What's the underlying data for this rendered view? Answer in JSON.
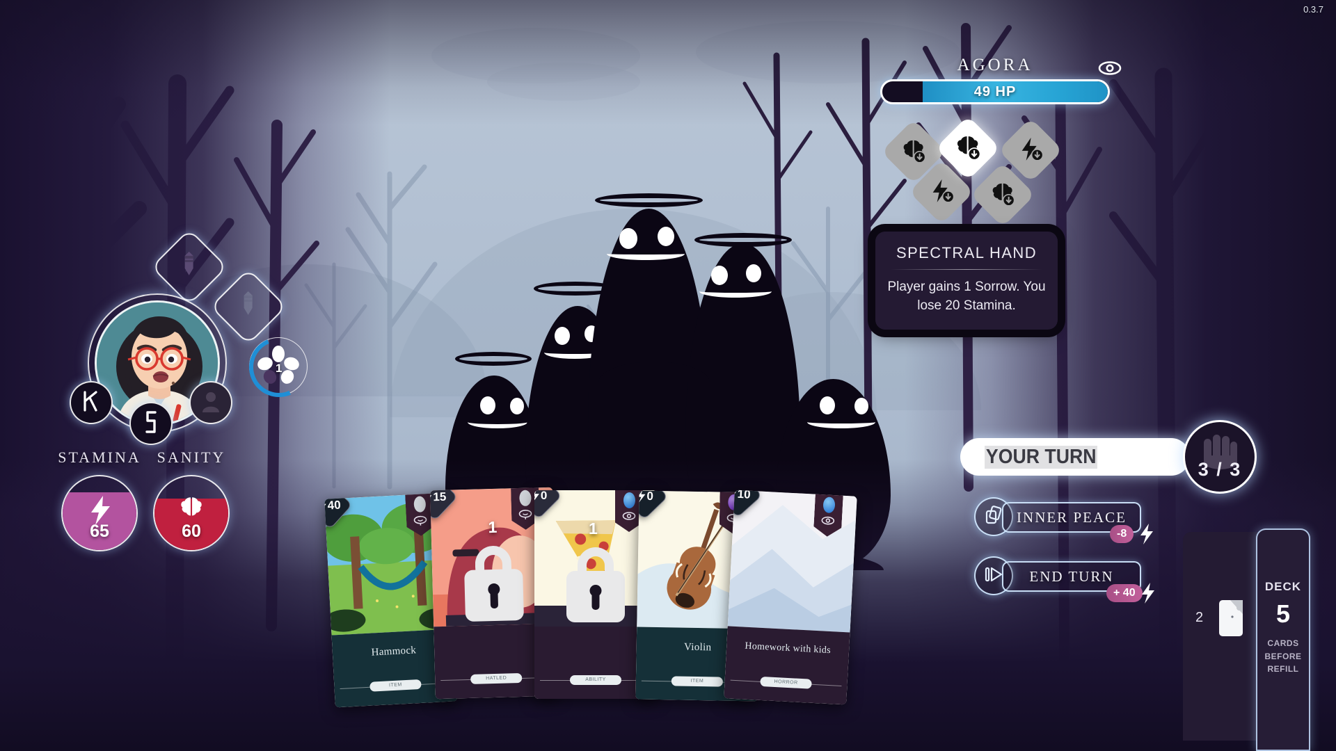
{
  "version": "0.3.7",
  "enemy": {
    "name": "AGORA",
    "hp_text": "49 HP",
    "hp_percent": 82,
    "eye_icon": "eye-icon",
    "intents": [
      {
        "icon": "brain-down-icon",
        "active": false
      },
      {
        "icon": "lightning-down-icon",
        "active": false
      },
      {
        "icon": "brain-down-icon",
        "active": true
      },
      {
        "icon": "brain-down-icon",
        "active": false
      },
      {
        "icon": "lightning-down-icon",
        "active": false
      }
    ]
  },
  "tooltip": {
    "title": "SPECTRAL HAND",
    "body": "Player gains 1 Sorrow. You lose 20 Stamina."
  },
  "player": {
    "avatar": "player-portrait",
    "equipment_slots": [
      {
        "icon": "sword-icon"
      },
      {
        "icon": "sword-icon"
      }
    ],
    "actions": [
      {
        "icon": "rune-k-icon"
      },
      {
        "icon": "rune-lightning-icon"
      },
      {
        "icon": "person-icon"
      }
    ],
    "sorrow": {
      "icon": "flower-icon",
      "value": "1"
    },
    "stats": [
      {
        "label": "STAMINA",
        "value": "65",
        "color": "#b3539f",
        "icon": "lightning-icon",
        "fill_percent": 78
      },
      {
        "label": "SANITY",
        "value": "60",
        "color": "#c0203f",
        "icon": "brain-icon",
        "fill_percent": 70
      }
    ]
  },
  "turn": {
    "banner_text": "YOUR TURN",
    "hand_icon": "hand-icon",
    "hand_count": "3 / 3"
  },
  "actions": [
    {
      "label": "INNER PEACE",
      "icon": "cards-icon",
      "cost": "-8",
      "cost_icon": "lightning-icon"
    },
    {
      "label": "END TURN",
      "icon": "skip-icon",
      "cost": "+ 40",
      "cost_icon": "lightning-icon"
    }
  ],
  "discard": {
    "count": "2",
    "icon": "cards-back-icon"
  },
  "deck": {
    "title": "DECK",
    "count": "5",
    "subtitle": "CARDS\nBEFORE\nREFILL"
  },
  "hand_cards": [
    {
      "name": "Hammock",
      "type": "ITEM",
      "cost": "40",
      "art": "hammock-scene",
      "ribbon_gem": "#cfd3d8",
      "ribbon_icon": "sanity-icon",
      "locked": false,
      "badge": "",
      "foot_color": "#153038"
    },
    {
      "name": "",
      "type": "HATLED",
      "cost": "15",
      "art": "person-stomach-scene",
      "ribbon_gem": "#cfd3d8",
      "ribbon_icon": "sanity-icon",
      "locked": true,
      "badge": "1",
      "foot_color": "#2a1b31"
    },
    {
      "name": "",
      "type": "ABILITY",
      "cost": "0",
      "art": "pizza-scene",
      "ribbon_gem": "#3a8fe0",
      "ribbon_icon": "eye-icon",
      "locked": true,
      "badge": "1",
      "foot_color": "#2a1b31"
    },
    {
      "name": "Violin",
      "type": "ITEM",
      "cost": "0",
      "art": "violin-scene",
      "ribbon_gem": "#8b45d6",
      "ribbon_icon": "sanity-icon",
      "locked": false,
      "badge": "",
      "foot_color": "#153038"
    },
    {
      "name": "Homework with kids",
      "type": "HORROR",
      "cost": "10",
      "art": "mountain-scene",
      "ribbon_gem": "#3a8fe0",
      "ribbon_icon": "eye-icon",
      "locked": false,
      "badge": "",
      "foot_color": "#2a1b31"
    }
  ]
}
